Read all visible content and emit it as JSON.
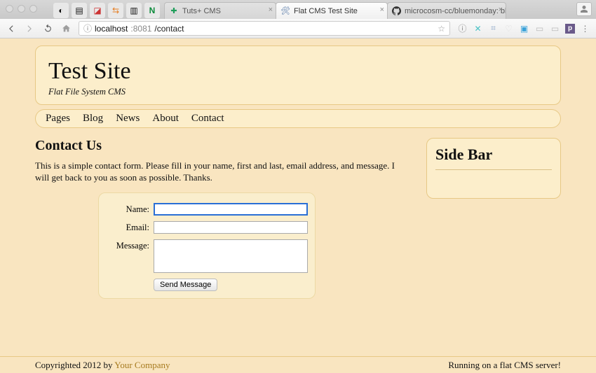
{
  "browser": {
    "tabs": [
      {
        "label": "Tuts+ CMS",
        "active": false
      },
      {
        "label": "Flat CMS Test Site",
        "active": true
      },
      {
        "label": "microcosm-cc/bluemonday: bl",
        "active": false
      }
    ],
    "address": {
      "host": "localhost",
      "port": ":8081",
      "path": "/contact"
    }
  },
  "site": {
    "title": "Test Site",
    "tagline": "Flat File System CMS"
  },
  "nav": {
    "items": [
      "Pages",
      "Blog",
      "News",
      "About",
      "Contact"
    ]
  },
  "page": {
    "heading": "Contact Us",
    "intro": "This is a simple contact form. Please fill in your name, first and last, email address, and message. I will get back to you as soon as possible. Thanks."
  },
  "form": {
    "labels": {
      "name": "Name:",
      "email": "Email:",
      "message": "Message:"
    },
    "values": {
      "name": "",
      "email": "",
      "message": ""
    },
    "submit": "Send Message"
  },
  "sidebar": {
    "heading": "Side Bar"
  },
  "footer": {
    "left_prefix": "Copyrighted 2012 by ",
    "left_link": "Your Company",
    "right": "Running on a flat CMS server!"
  }
}
